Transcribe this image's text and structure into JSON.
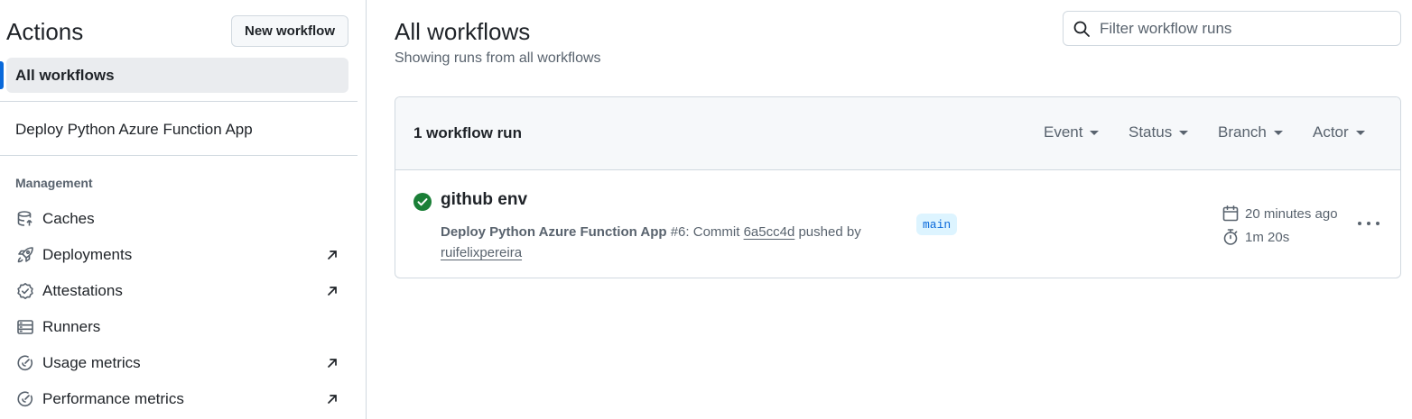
{
  "sidebar": {
    "title": "Actions",
    "new_workflow_label": "New workflow",
    "active_item": "All workflows",
    "workflow_item": "Deploy Python Azure Function App",
    "management_label": "Management",
    "management_items": [
      {
        "label": "Caches",
        "icon": "database-icon",
        "external": false
      },
      {
        "label": "Deployments",
        "icon": "rocket-icon",
        "external": true
      },
      {
        "label": "Attestations",
        "icon": "verified-icon",
        "external": true
      },
      {
        "label": "Runners",
        "icon": "server-icon",
        "external": false
      },
      {
        "label": "Usage metrics",
        "icon": "meter-icon",
        "external": true
      },
      {
        "label": "Performance metrics",
        "icon": "meter-icon",
        "external": true
      }
    ]
  },
  "main": {
    "title": "All workflows",
    "subtitle": "Showing runs from all workflows",
    "filter_placeholder": "Filter workflow runs",
    "runs_count": "1 workflow run",
    "filters": [
      "Event",
      "Status",
      "Branch",
      "Actor"
    ],
    "run": {
      "status": "success",
      "title": "github env",
      "workflow_name": "Deploy Python Azure Function App",
      "run_number": "#6",
      "commit_prefix": ": Commit",
      "commit_sha": "6a5cc4d",
      "pushed_by": "pushed by",
      "actor": "ruifelixpereira",
      "branch": "main",
      "time_ago": "20 minutes ago",
      "duration": "1m 20s"
    }
  },
  "colors": {
    "accent": "#0969da",
    "success": "#1a7f37",
    "muted": "#59636e",
    "border": "#d1d9e0"
  }
}
